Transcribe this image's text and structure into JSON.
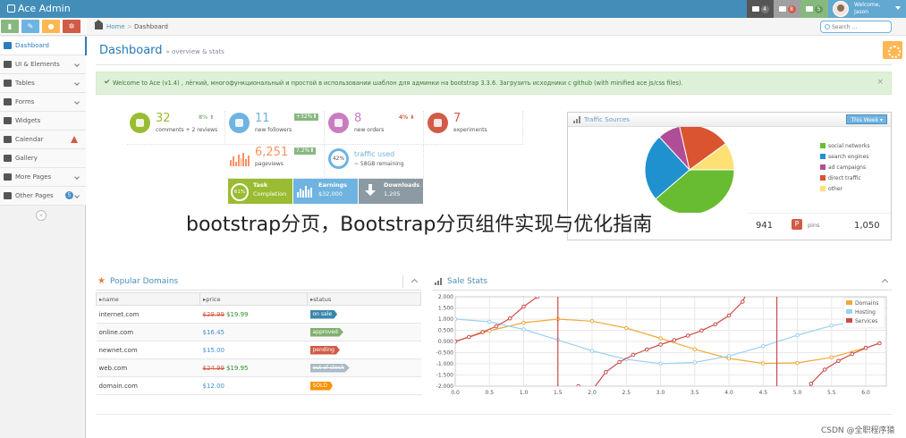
{
  "app": {
    "brand": "Ace Admin",
    "user_welcome": "Welcome,",
    "user_name": "Jason"
  },
  "navbar": {
    "buttons": [
      {
        "name": "tasks",
        "count": "4",
        "bg": "#555",
        "badge": "#777"
      },
      {
        "name": "notifications",
        "count": "8",
        "bg": "#a0a0a0",
        "badge": "#d15b47"
      },
      {
        "name": "messages",
        "count": "5",
        "bg": "#87b87f",
        "badge": "#629b58"
      }
    ]
  },
  "sidebar": {
    "shortcuts": [
      {
        "icon": "signal-icon",
        "color": "#87b87f"
      },
      {
        "icon": "pencil-icon",
        "color": "#6fb3e0"
      },
      {
        "icon": "users-icon",
        "color": "#ffb752"
      },
      {
        "icon": "cogs-icon",
        "color": "#d15b47"
      }
    ],
    "items": [
      {
        "label": "Dashboard",
        "active": true,
        "chevron": false
      },
      {
        "label": "UI & Elements",
        "chevron": true
      },
      {
        "label": "Tables",
        "chevron": true
      },
      {
        "label": "Forms",
        "chevron": true
      },
      {
        "label": "Widgets",
        "chevron": false
      },
      {
        "label": "Calendar",
        "chevron": false,
        "warning": true
      },
      {
        "label": "Gallery",
        "chevron": false
      },
      {
        "label": "More Pages",
        "chevron": true
      },
      {
        "label": "Other Pages",
        "chevron": true,
        "badge": "5"
      }
    ]
  },
  "breadcrumb": {
    "home": "Home",
    "separator": ">",
    "current": "Dashboard"
  },
  "search": {
    "placeholder": "Search ..."
  },
  "page": {
    "title": "Dashboard",
    "subtitle": "» overview & stats"
  },
  "alert": {
    "prefix": "Welcome to Ace ",
    "version": "(v1.4)",
    "body": " , лёгкий, многофункциональный и простой в использовании шаблон для админки на bootstrap 3.3.6. Загрузить исходники с ",
    "link": "github",
    "suffix": " (with minified ace js/css files)."
  },
  "infoboxes": [
    {
      "value": "32",
      "label": "comments + 2 reviews",
      "stat": "8%",
      "stat_color": "#87b87f",
      "icon_color": "#9abc32",
      "num_color": "#9abc32"
    },
    {
      "value": "11",
      "label": "new followers",
      "stat": "+32%",
      "stat_color": "#87b87f",
      "icon_color": "#6fb3e0",
      "num_color": "#6fb3e0"
    },
    {
      "value": "8",
      "label": "new orders",
      "stat": "4%",
      "stat_color": "#d15b47",
      "icon_color": "#c97dc0",
      "num_color": "#c97dc0"
    },
    {
      "value": "7",
      "label": "experiments",
      "stat": "",
      "icon_color": "#d15b47",
      "num_color": "#d15b47"
    },
    {
      "value": "6,251",
      "label": "pageviews",
      "stat": "7.2%",
      "stat_color": "#87b87f",
      "num_color": "#f79263"
    },
    {
      "value": "traffic used",
      "label": "~ 58GB remaining",
      "ring": "42%",
      "num_color": "#6fb3e0"
    }
  ],
  "dark_boxes": [
    {
      "label": "Task",
      "value": "Completion",
      "ring": "61%",
      "color": "#9abc32"
    },
    {
      "label": "Earnings",
      "value": "$32,000",
      "color": "#6fb3e0"
    },
    {
      "label": "Downloads",
      "value": "1,205",
      "color": "#8b9aa3"
    }
  ],
  "traffic": {
    "title": "Traffic Sources",
    "period": "This Week",
    "legend": [
      {
        "label": "social networks",
        "value": 38.7,
        "color": "#68bc31"
      },
      {
        "label": "search engines",
        "value": 24.5,
        "color": "#2091cf"
      },
      {
        "label": "ad campaigns",
        "value": 8.2,
        "color": "#af4e96"
      },
      {
        "label": "direct traffic",
        "value": 18.6,
        "color": "#da5430"
      },
      {
        "label": "other",
        "value": 10,
        "color": "#fee074"
      }
    ],
    "stats": [
      {
        "value": "941"
      },
      {
        "label": "pins",
        "value": "1,050"
      }
    ]
  },
  "watermark": "bootstrap分页，Bootstrap分页组件实现与优化指南",
  "credit": "CSDN @全职程序猿",
  "popular_domains": {
    "title": "Popular Domains",
    "columns": [
      "name",
      "price",
      "status"
    ],
    "rows": [
      {
        "name": "internet.com",
        "old_price": "$29.99",
        "price": "$19.99",
        "status": "on sale",
        "status_color": "#3a87ad"
      },
      {
        "name": "online.com",
        "old_price": "",
        "price": "$16.45",
        "status": "approved",
        "status_color": "#82af6f"
      },
      {
        "name": "newnet.com",
        "old_price": "",
        "price": "$15.00",
        "status": "pending",
        "status_color": "#d15b47"
      },
      {
        "name": "web.com",
        "old_price": "$24.99",
        "price": "$19.95",
        "status": "out of stock",
        "status_color": "#abbac3"
      },
      {
        "name": "domain.com",
        "old_price": "",
        "price": "$12.00",
        "status": "SOLD",
        "status_color": "#f89406"
      }
    ]
  },
  "sale_stats": {
    "title": "Sale Stats"
  },
  "chart_data": [
    {
      "type": "pie",
      "title": "Traffic Sources",
      "categories": [
        "social networks",
        "search engines",
        "ad campaigns",
        "direct traffic",
        "other"
      ],
      "values": [
        38.7,
        24.5,
        8.2,
        18.6,
        10
      ],
      "colors": [
        "#68bc31",
        "#2091cf",
        "#af4e96",
        "#da5430",
        "#fee074"
      ],
      "legend": "right"
    },
    {
      "type": "line",
      "title": "Sale Stats",
      "xlim": [
        0,
        6.3
      ],
      "ylim": [
        -2,
        2
      ],
      "x_ticks": [
        "0.0",
        "0.5",
        "1.0",
        "1.5",
        "2.0",
        "2.5",
        "3.0",
        "3.5",
        "4.0",
        "4.5",
        "5.0",
        "5.5",
        "6.0"
      ],
      "y_ticks": [
        "2.000",
        "1.500",
        "1.000",
        "0.500",
        "0.000",
        "-0.500",
        "-1.000",
        "-1.500",
        "-2.000"
      ],
      "grid": true,
      "legend": "top-right",
      "series": [
        {
          "name": "Domains",
          "color": "#f2a83a",
          "x": [
            0,
            0.5,
            1,
            1.5,
            2,
            2.5,
            3,
            3.5,
            4,
            4.5,
            5,
            5.5,
            6
          ],
          "y": [
            0.0,
            0.48,
            0.84,
            1.0,
            0.91,
            0.6,
            0.14,
            -0.35,
            -0.76,
            -0.98,
            -0.96,
            -0.71,
            -0.28
          ]
        },
        {
          "name": "Hosting",
          "color": "#9cd1ef",
          "x": [
            0,
            0.5,
            1,
            1.5,
            2,
            2.5,
            3,
            3.5,
            4,
            4.5,
            5,
            5.5,
            6
          ],
          "y": [
            1.0,
            0.88,
            0.54,
            0.07,
            -0.42,
            -0.8,
            -0.99,
            -0.94,
            -0.65,
            -0.21,
            0.28,
            0.71,
            0.96
          ]
        },
        {
          "name": "Services",
          "color": "#cb4b4b",
          "x": [
            0,
            0.2,
            0.4,
            0.6,
            0.8,
            1.0,
            1.2,
            1.8,
            2.0,
            2.2,
            2.4,
            2.6,
            2.8,
            3.0,
            3.2,
            3.4,
            3.6,
            3.8,
            4.0,
            4.2,
            4.4,
            5.0,
            5.2,
            5.4,
            5.6,
            5.8,
            6.0,
            6.2
          ],
          "y": [
            0.0,
            0.2,
            0.42,
            0.68,
            1.03,
            1.56,
            2.0,
            -2.0,
            -2.19,
            -1.37,
            -0.92,
            -0.6,
            -0.36,
            -0.14,
            0.06,
            0.26,
            0.49,
            0.77,
            1.16,
            1.78,
            3.1,
            -3.38,
            -1.89,
            -1.26,
            -0.87,
            -0.56,
            -0.29,
            -0.08
          ]
        }
      ]
    }
  ]
}
